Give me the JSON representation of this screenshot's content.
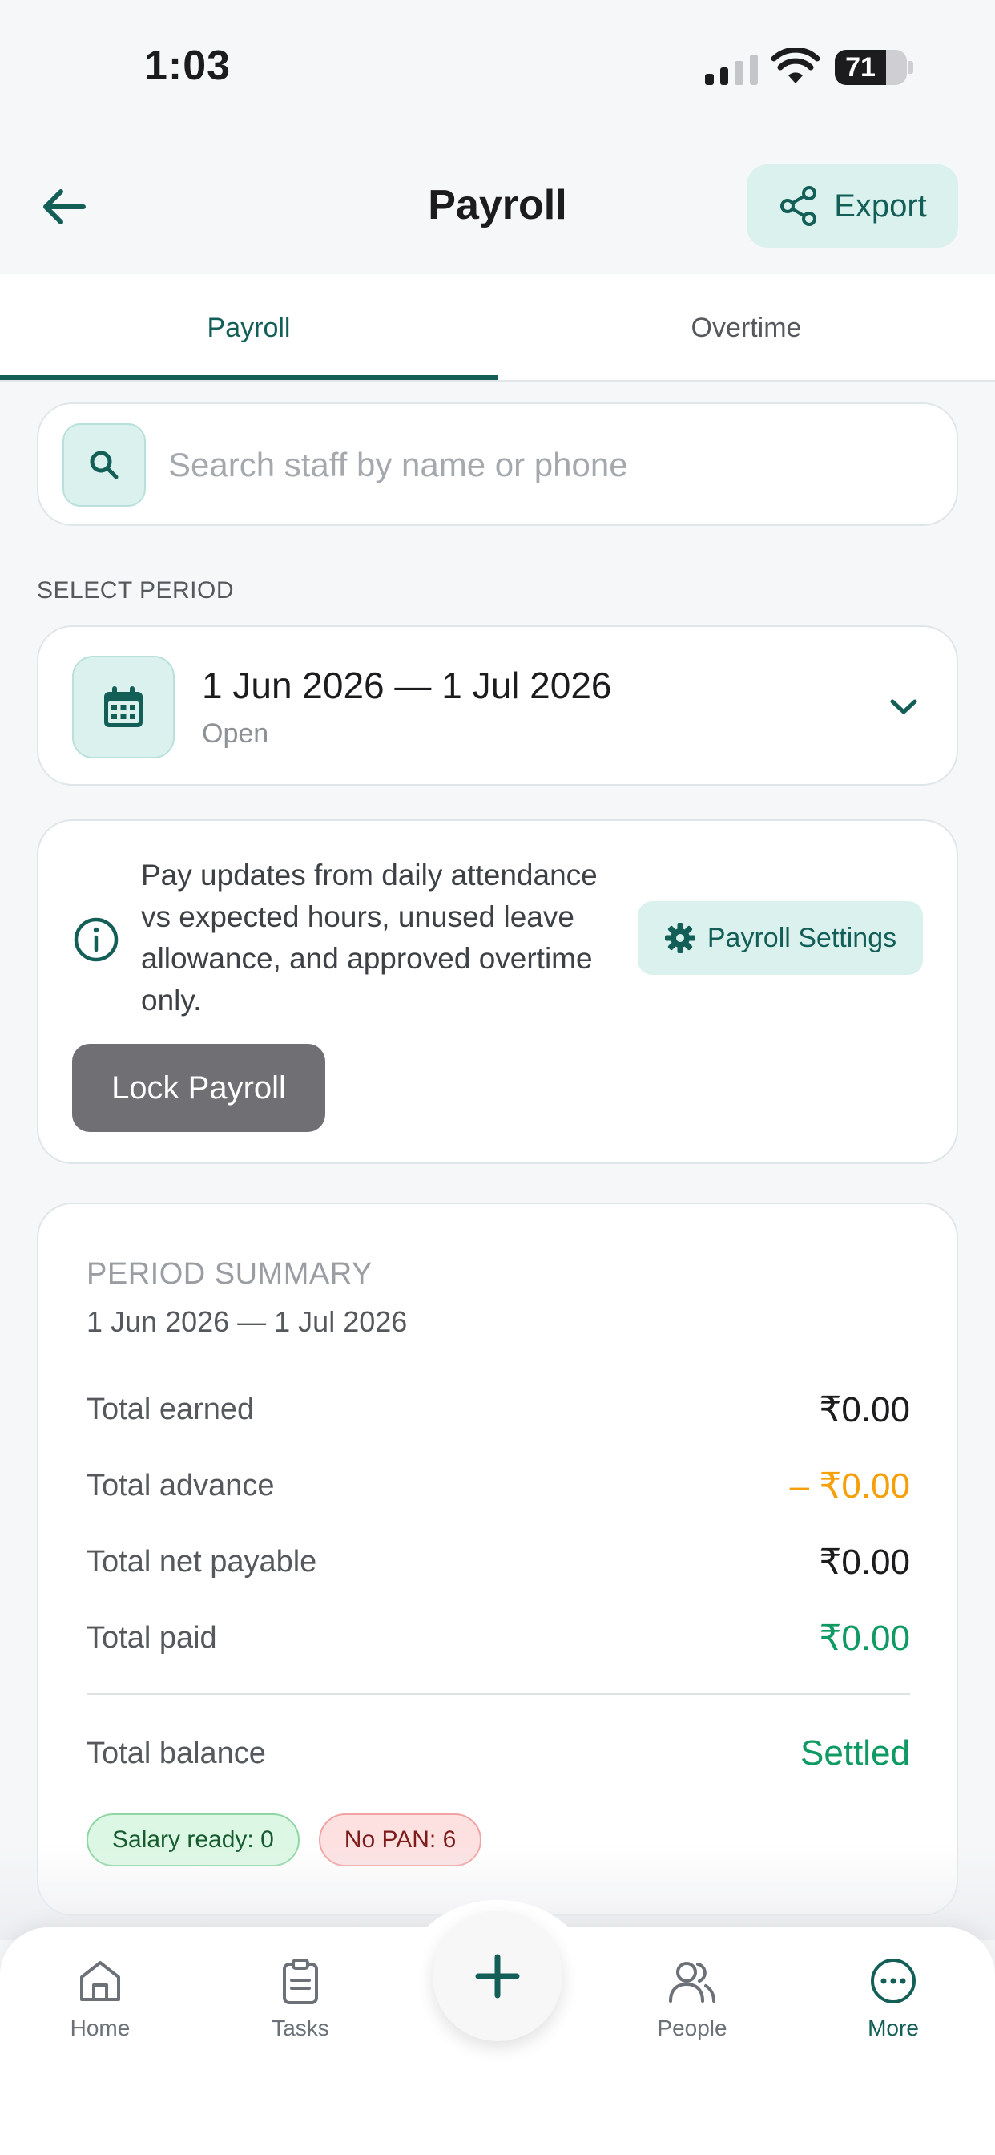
{
  "status_bar": {
    "time": "1:03",
    "battery": "71"
  },
  "header": {
    "title": "Payroll",
    "export_label": "Export"
  },
  "tabs": [
    {
      "label": "Payroll",
      "active": true
    },
    {
      "label": "Overtime",
      "active": false
    }
  ],
  "search": {
    "placeholder": "Search staff by name or phone",
    "value": ""
  },
  "period": {
    "section_label": "SELECT PERIOD",
    "range": "1 Jun 2026 — 1 Jul 2026",
    "status": "Open"
  },
  "info": {
    "text": "Pay updates from daily attendance vs expected hours, unused leave allowance, and approved overtime only.",
    "settings_label": "Payroll Settings",
    "lock_label": "Lock Payroll"
  },
  "summary": {
    "heading": "PERIOD SUMMARY",
    "range": "1 Jun 2026 — 1 Jul 2026",
    "rows": [
      {
        "label": "Total earned",
        "value": "₹0.00"
      },
      {
        "label": "Total advance",
        "value": "– ₹0.00"
      },
      {
        "label": "Total net payable",
        "value": "₹0.00"
      },
      {
        "label": "Total paid",
        "value": "₹0.00"
      }
    ],
    "balance_label": "Total balance",
    "balance_value": "Settled",
    "badges": [
      {
        "label": "Salary ready: 0"
      },
      {
        "label": "No PAN: 6"
      }
    ]
  },
  "colors": {
    "accent": "#135f57",
    "accent_light": "#dbf1ee",
    "advance": "#f5a00a",
    "paid": "#0f9a63"
  },
  "bottom_nav": [
    {
      "label": "Home",
      "icon": "home-icon",
      "active": false
    },
    {
      "label": "Tasks",
      "icon": "clipboard-icon",
      "active": false
    },
    {
      "label": "People",
      "icon": "people-icon",
      "active": false
    },
    {
      "label": "More",
      "icon": "more-icon",
      "active": true
    }
  ]
}
